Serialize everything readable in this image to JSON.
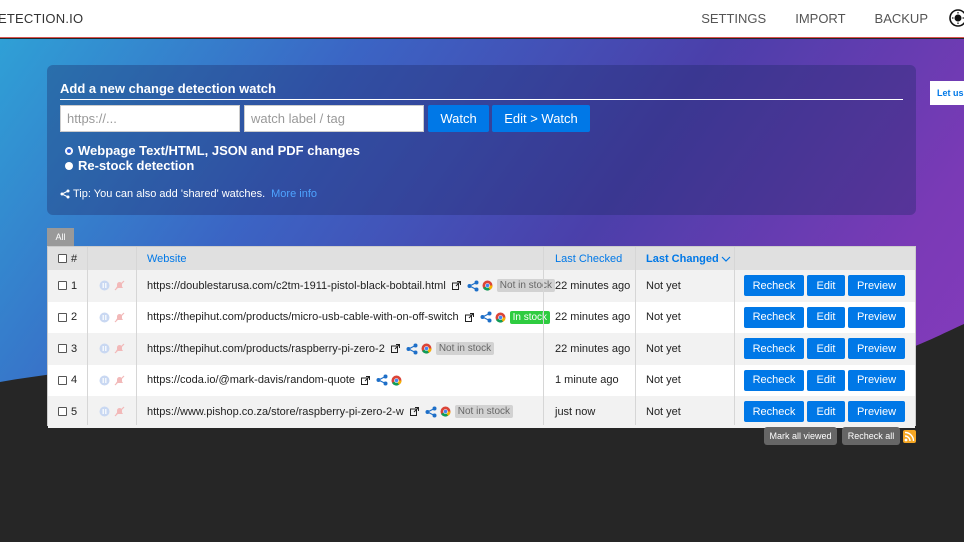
{
  "header": {
    "brand": "ETECTION.IO",
    "nav": [
      "SETTINGS",
      "IMPORT",
      "BACKUP"
    ]
  },
  "new_watch": {
    "title": "Add a new change detection watch",
    "url_placeholder": "https://...",
    "tag_placeholder": "watch label / tag",
    "watch_label": "Watch",
    "edit_watch_label": "Edit > Watch",
    "options": [
      {
        "label": "Webpage Text/HTML, JSON and PDF changes",
        "selected": true
      },
      {
        "label": "Re-stock detection",
        "selected": false
      }
    ],
    "tip_text": "Tip: You can also add 'shared' watches.",
    "tip_link": "More info"
  },
  "side_badge": "Let us",
  "tabs": [
    "All"
  ],
  "table": {
    "headers": {
      "num": "#",
      "website": "Website",
      "last_checked": "Last Checked",
      "last_changed": "Last Changed"
    },
    "rows": [
      {
        "num": "1",
        "url": "https://doublestarusa.com/c2tm-1911-pistol-black-bobtail.html",
        "stock": "Not in stock",
        "last_checked": "22 minutes ago",
        "last_changed": "Not yet"
      },
      {
        "num": "2",
        "url": "https://thepihut.com/products/micro-usb-cable-with-on-off-switch",
        "stock": "In stock",
        "last_checked": "22 minutes ago",
        "last_changed": "Not yet"
      },
      {
        "num": "3",
        "url": "https://thepihut.com/products/raspberry-pi-zero-2",
        "stock": "Not in stock",
        "last_checked": "22 minutes ago",
        "last_changed": "Not yet"
      },
      {
        "num": "4",
        "url": "https://coda.io/@mark-davis/random-quote",
        "stock": "",
        "last_checked": "1 minute ago",
        "last_changed": "Not yet"
      },
      {
        "num": "5",
        "url": "https://www.pishop.co.za/store/raspberry-pi-zero-2-w",
        "stock": "Not in stock",
        "last_checked": "just now",
        "last_changed": "Not yet"
      }
    ],
    "actions": {
      "recheck": "Recheck",
      "edit": "Edit",
      "preview": "Preview"
    }
  },
  "footer_buttons": {
    "mark_all_viewed": "Mark all viewed",
    "recheck_all": "Recheck all"
  },
  "colors": {
    "accent": "#0078e7",
    "in_stock": "#2ecc40",
    "header_border": "#d9534f"
  }
}
